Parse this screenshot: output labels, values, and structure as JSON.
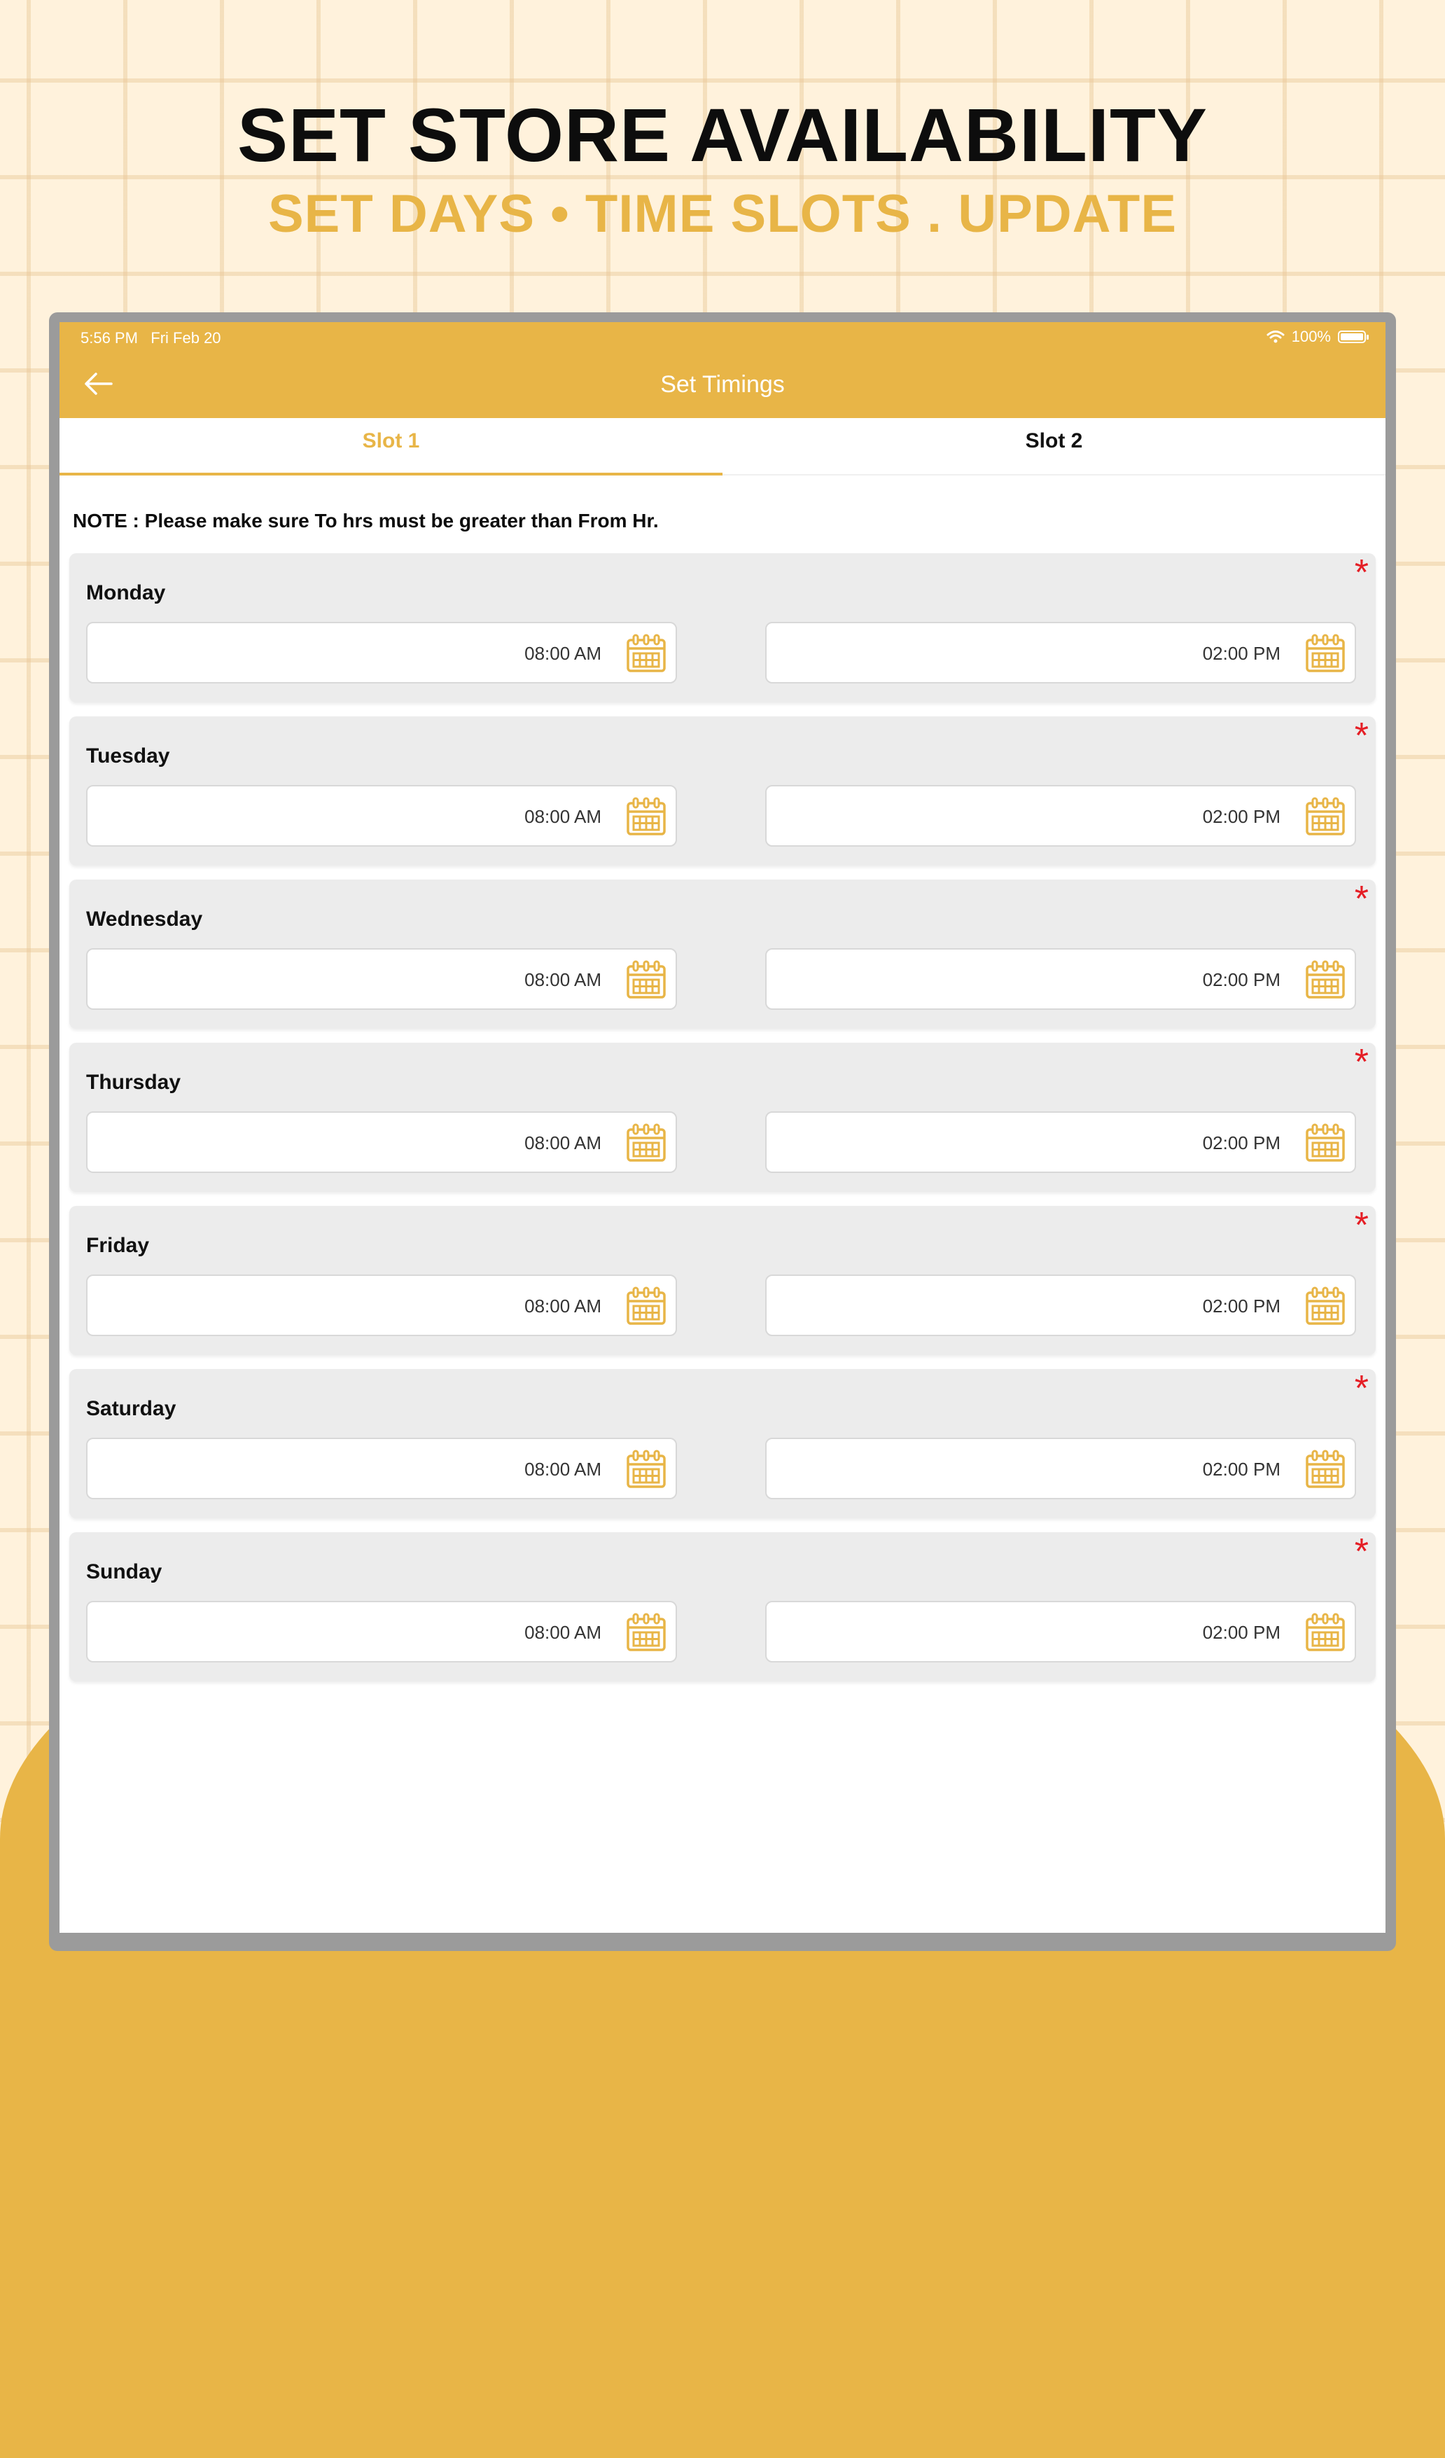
{
  "promo": {
    "headline": "SET STORE AVAILABILITY",
    "subhead": "SET DAYS • TIME SLOTS . UPDATE"
  },
  "status_bar": {
    "time": "5:56 PM",
    "date": "Fri Feb 20",
    "battery": "100%"
  },
  "app_bar": {
    "title": "Set Timings",
    "back_icon": "arrow-left-icon"
  },
  "tabs": [
    {
      "label": "Slot 1",
      "active": true
    },
    {
      "label": "Slot 2",
      "active": false
    }
  ],
  "note": "NOTE : Please make sure To hrs must be greater than From Hr.",
  "required_marker": "*",
  "days": [
    {
      "name": "Monday",
      "from": "08:00 AM",
      "to": "02:00 PM"
    },
    {
      "name": "Tuesday",
      "from": "08:00 AM",
      "to": "02:00 PM"
    },
    {
      "name": "Wednesday",
      "from": "08:00 AM",
      "to": "02:00 PM"
    },
    {
      "name": "Thursday",
      "from": "08:00 AM",
      "to": "02:00 PM"
    },
    {
      "name": "Friday",
      "from": "08:00 AM",
      "to": "02:00 PM"
    },
    {
      "name": "Saturday",
      "from": "08:00 AM",
      "to": "02:00 PM"
    },
    {
      "name": "Sunday",
      "from": "08:00 AM",
      "to": "02:00 PM"
    }
  ],
  "colors": {
    "accent": "#e8b547",
    "required": "#e51e25",
    "card_bg": "#ececec",
    "page_bg": "#fff2dc"
  },
  "icons": {
    "field_icon": "calendar-icon",
    "wifi": "wifi-icon",
    "battery": "battery-icon"
  }
}
